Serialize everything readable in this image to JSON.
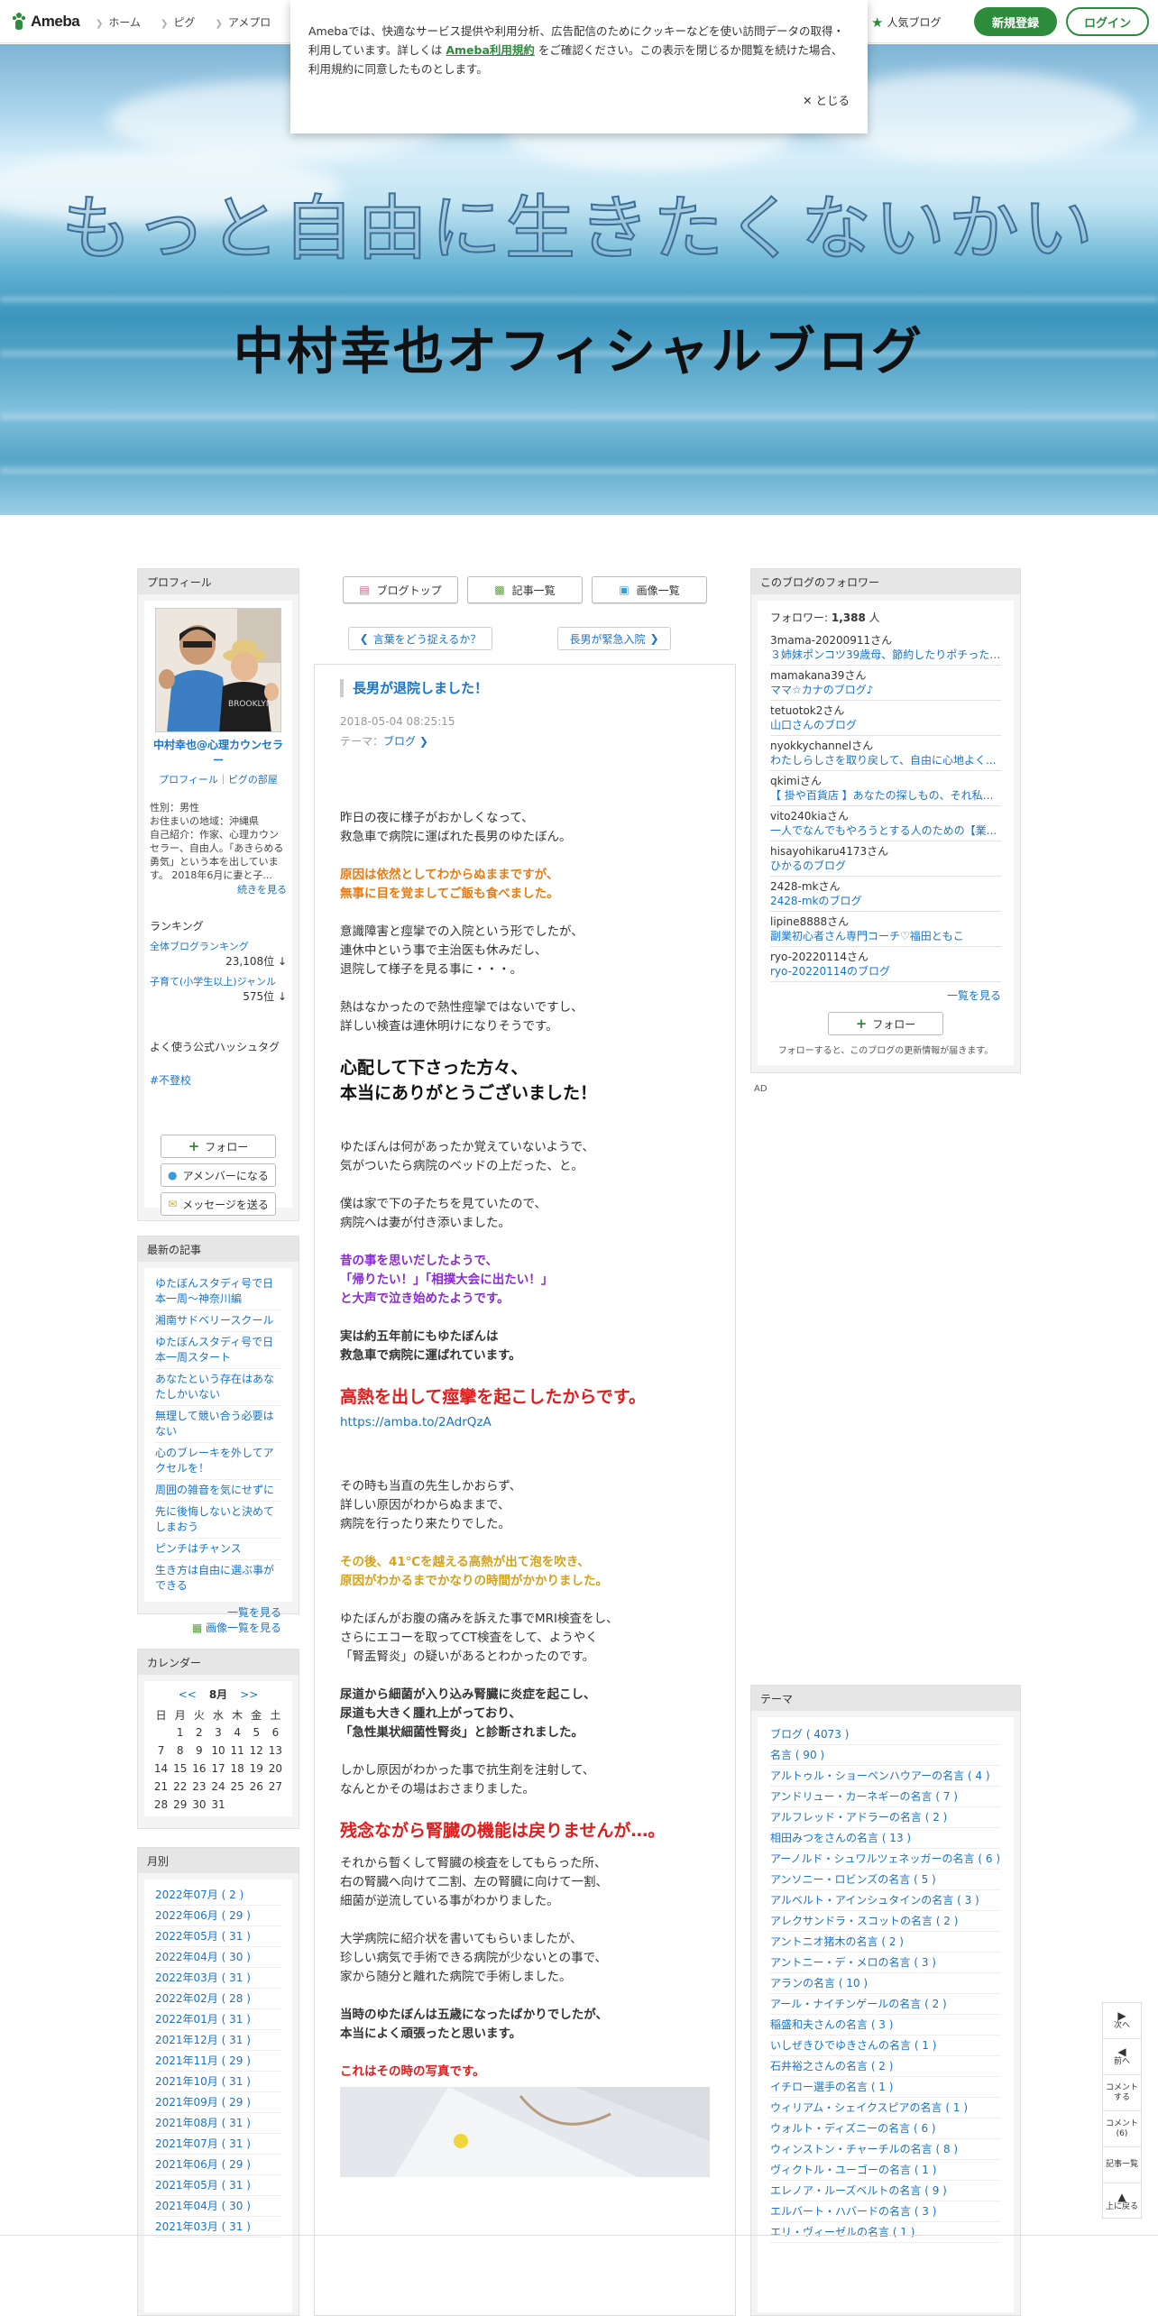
{
  "header": {
    "logo": "Ameba",
    "nav": [
      "ホーム",
      "ピグ",
      "アメプロ"
    ],
    "popular": "人気ブログ",
    "signup": "新規登録",
    "login": "ログイン"
  },
  "cookie": {
    "text_before": "Amebaでは、快適なサービス提供や利用分析、広告配信のためにクッキーなどを使い訪問データの取得・利用しています。詳しくは ",
    "terms_link": "Ameba利用規約",
    "text_after": " をご確認ください。この表示を閉じるか閲覧を続けた場合、利用規約に同意したものとします。",
    "close": "とじる"
  },
  "banner": {
    "line1": "もっと自由に生きたくないかい",
    "line2": "中村幸也オフィシャルブログ"
  },
  "profile": {
    "heading": "プロフィール",
    "name": "中村幸也@心理カウンセラー",
    "links": "プロフィール｜ピグの部屋",
    "info": "性別：男性\nお住まいの地域：沖縄県\n自己紹介：作家、心理カウンセラー、自由人。「あきらめる勇気」という本を出しています。 2018年6月に妻と子...",
    "more": "続きを見る",
    "ranking_heading": "ランキング",
    "ranking_all": "全体ブログランキング",
    "ranking_all_value": "23,108位 ↓",
    "ranking_genre": "子育て(小学生以上)ジャンル",
    "ranking_genre_value": "575位 ↓",
    "hashtag_heading": "よく使う公式ハッシュタグ",
    "hashtag": "#不登校",
    "follow": "フォロー",
    "member": "アメンバーになる",
    "message": "メッセージを送る"
  },
  "top_buttons": {
    "blog_top": "ブログトップ",
    "entries": "記事一覧",
    "images": "画像一覧"
  },
  "pager": {
    "prev": "言葉をどう捉えるか？",
    "next": "長男が緊急入院"
  },
  "article": {
    "title": "長男が退院しました！",
    "date": "2018-05-04 08:25:15",
    "theme_label": "テーマ：",
    "theme": "ブログ",
    "paragraphs": [
      {
        "style": "normal",
        "text": "昨日の夜に様子がおかしくなって、\n救急車で病院に運ばれた長男のゆたぼん。"
      },
      {
        "style": "orange",
        "text": "原因は依然としてわからぬままですが、\n無事に目を覚ましてご飯も食べました。"
      },
      {
        "style": "normal",
        "text": "意識障害と痙攣での入院という形でしたが、\n連休中という事で主治医も休みだし、\n退院して様子を見る事に・・・。"
      },
      {
        "style": "normal",
        "text": "熱はなかったので熱性痙攣ではないですし、\n詳しい検査は連休明けになりそうです。"
      },
      {
        "style": "big",
        "text": "心配して下さった方々、\n本当にありがとうございました！"
      },
      {
        "style": "normal",
        "text": "ゆたぼんは何があったか覚えていないようで、\n気がついたら病院のベッドの上だった、と。"
      },
      {
        "style": "normal",
        "text": "僕は家で下の子たちを見ていたので、\n病院へは妻が付き添いました。"
      },
      {
        "style": "purple",
        "text": "昔の事を思いだしたようで、\n「帰りたい！」「相撲大会に出たい！」\nと大声で泣き始めたようです。"
      },
      {
        "style": "bold",
        "text": "実は約五年前にもゆたぼんは\n救急車で病院に運ばれています。"
      },
      {
        "style": "red",
        "text": "高熱を出して痙攣を起こしたからです。"
      },
      {
        "style": "link",
        "text": "https://amba.to/2AdrQzA"
      },
      {
        "style": "normal",
        "text": "その時も当直の先生しかおらず、\n詳しい原因がわからぬままで、\n病院を行ったり来たりでした。"
      },
      {
        "style": "gold",
        "text": "その後、41℃を越える高熱が出て泡を吹き、\n原因がわかるまでかなりの時間がかかりました。"
      },
      {
        "style": "normal",
        "text": "ゆたぼんがお腹の痛みを訴えた事でMRI検査をし、\nさらにエコーを取ってCT検査をして、ようやく\n「腎盂腎炎」の疑いがあるとわかったのです。"
      },
      {
        "style": "bold",
        "text": "尿道から細菌が入り込み腎臓に炎症を起こし、\n尿道も大きく腫れ上がっており、\n「急性巣状細菌性腎炎」と診断されました。"
      },
      {
        "style": "normal",
        "text": "しかし原因がわかった事で抗生剤を注射して、\nなんとかその場はおさまりました。"
      },
      {
        "style": "red",
        "text": "残念ながら腎臓の機能は戻りませんが…。"
      },
      {
        "style": "spacer",
        "text": ""
      },
      {
        "style": "normal",
        "text": "それから暫くして腎臓の検査をしてもらった所、\n右の腎臓へ向けて二割、左の腎臓に向けて一割、\n細菌が逆流している事がわかりました。"
      },
      {
        "style": "normal",
        "text": "大学病院に紹介状を書いてもらいましたが、\n珍しい病気で手術できる病院が少ないとの事で、\n家から随分と離れた病院で手術しました。"
      },
      {
        "style": "bold",
        "text": "当時のゆたぼんは五歳になったばかりでしたが、\n本当によく頑張ったと思います。"
      },
      {
        "style": "redsm",
        "text": "これはその時の写真です。"
      }
    ]
  },
  "followers": {
    "heading": "このブログのフォロワー",
    "count_label": "フォロワー: ",
    "count": "1,388",
    "count_unit": "人",
    "items": [
      {
        "user": "3mama-20200911さん",
        "blog": "３姉妹ポンコツ39歳母、節約したりポチったり..."
      },
      {
        "user": "mamakana39さん",
        "blog": "ママ☆カナのブログ♪"
      },
      {
        "user": "tetuotok2さん",
        "blog": "山口さんのブログ"
      },
      {
        "user": "nyokkychannelさん",
        "blog": "わたしらしさを取り戻して、自由に心地よく..."
      },
      {
        "user": "qkimiさん",
        "blog": "【 掛や百貨店 】あなたの探しもの、それ私が..."
      },
      {
        "user": "vito240kiaさん",
        "blog": "一人でなんでもやろうとする人のための【業..."
      },
      {
        "user": "hisayohikaru4173さん",
        "blog": "ひかるのブログ"
      },
      {
        "user": "2428-mkさん",
        "blog": "2428-mkのブログ"
      },
      {
        "user": "lipine8888さん",
        "blog": "副業初心者さん専門コーチ♡福田ともこ"
      },
      {
        "user": "ryo-20220114さん",
        "blog": "ryo-20220114のブログ"
      }
    ],
    "all": "一覧を見る",
    "follow": "フォロー",
    "note": "フォローすると、このブログの更新情報が届きます。"
  },
  "ad": "AD",
  "recent": {
    "heading": "最新の記事",
    "items": [
      "ゆたぼんスタディ号で日本一周〜神奈川編",
      "湘南サドベリースクール",
      "ゆたぼんスタディ号で日本一周スタート",
      "あなたという存在はあなたしかいない",
      "無理して競い合う必要はない",
      "心のブレーキを外してアクセルを！",
      "周囲の雑音を気にせずに",
      "先に後悔しないと決めてしまおう",
      "ピンチはチャンス",
      "生き方は自由に選ぶ事ができる"
    ],
    "all": "一覧を見る",
    "images": "画像一覧を見る"
  },
  "calendar": {
    "heading": "カレンダー",
    "prev": "<<",
    "month": "8月",
    "next": ">>",
    "weekdays": [
      "日",
      "月",
      "火",
      "水",
      "木",
      "金",
      "土"
    ],
    "weeks": [
      [
        "",
        "1",
        "2",
        "3",
        "4",
        "5",
        "6"
      ],
      [
        "7",
        "8",
        "9",
        "10",
        "11",
        "12",
        "13"
      ],
      [
        "14",
        "15",
        "16",
        "17",
        "18",
        "19",
        "20"
      ],
      [
        "21",
        "22",
        "23",
        "24",
        "25",
        "26",
        "27"
      ],
      [
        "28",
        "29",
        "30",
        "31",
        "",
        "",
        ""
      ]
    ]
  },
  "monthly": {
    "heading": "月別",
    "items": [
      "2022年07月 ( 2 )",
      "2022年06月 ( 29 )",
      "2022年05月 ( 31 )",
      "2022年04月 ( 30 )",
      "2022年03月 ( 31 )",
      "2022年02月 ( 28 )",
      "2022年01月 ( 31 )",
      "2021年12月 ( 31 )",
      "2021年11月 ( 29 )",
      "2021年10月 ( 31 )",
      "2021年09月 ( 29 )",
      "2021年08月 ( 31 )",
      "2021年07月 ( 31 )",
      "2021年06月 ( 29 )",
      "2021年05月 ( 31 )",
      "2021年04月 ( 30 )",
      "2021年03月 ( 31 )"
    ]
  },
  "themes": {
    "heading": "テーマ",
    "items": [
      "ブログ ( 4073 )",
      "名言 ( 90 )",
      "アルトゥル・ショーペンハウアーの名言 ( 4 )",
      "アンドリュー・カーネギーの名言 ( 7 )",
      "アルフレッド・アドラーの名言 ( 2 )",
      "相田みつをさんの名言 ( 13 )",
      "アーノルド・シュワルツェネッガーの名言 ( 6 )",
      "アンソニー・ロビンズの名言 ( 5 )",
      "アルベルト・アインシュタインの名言 ( 3 )",
      "アレクサンドラ・スコットの名言 ( 2 )",
      "アントニオ猪木の名言 ( 2 )",
      "アントニー・デ・メロの名言 ( 3 )",
      "アランの名言 ( 10 )",
      "アール・ナイチンゲールの名言 ( 2 )",
      "稲盛和夫さんの名言 ( 3 )",
      "いしぜきひでゆきさんの名言 ( 1 )",
      "石井裕之さんの名言 ( 2 )",
      "イチロー選手の名言 ( 1 )",
      "ウィリアム・シェイクスピアの名言 ( 1 )",
      "ウォルト・ディズニーの名言 ( 6 )",
      "ウィンストン・チャーチルの名言 ( 8 )",
      "ヴィクトル・ユーゴーの名言 ( 1 )",
      "エレノア・ルーズベルトの名言 ( 9 )",
      "エルバート・ハバードの名言 ( 3 )",
      "エリ・ヴィーゼルの名言 ( 1 )"
    ]
  },
  "floatnav": {
    "next": "次へ",
    "prev": "前へ",
    "comment": "コメントする",
    "comments": "コメント(6)",
    "entries": "記事一覧",
    "top": "上に戻る"
  }
}
